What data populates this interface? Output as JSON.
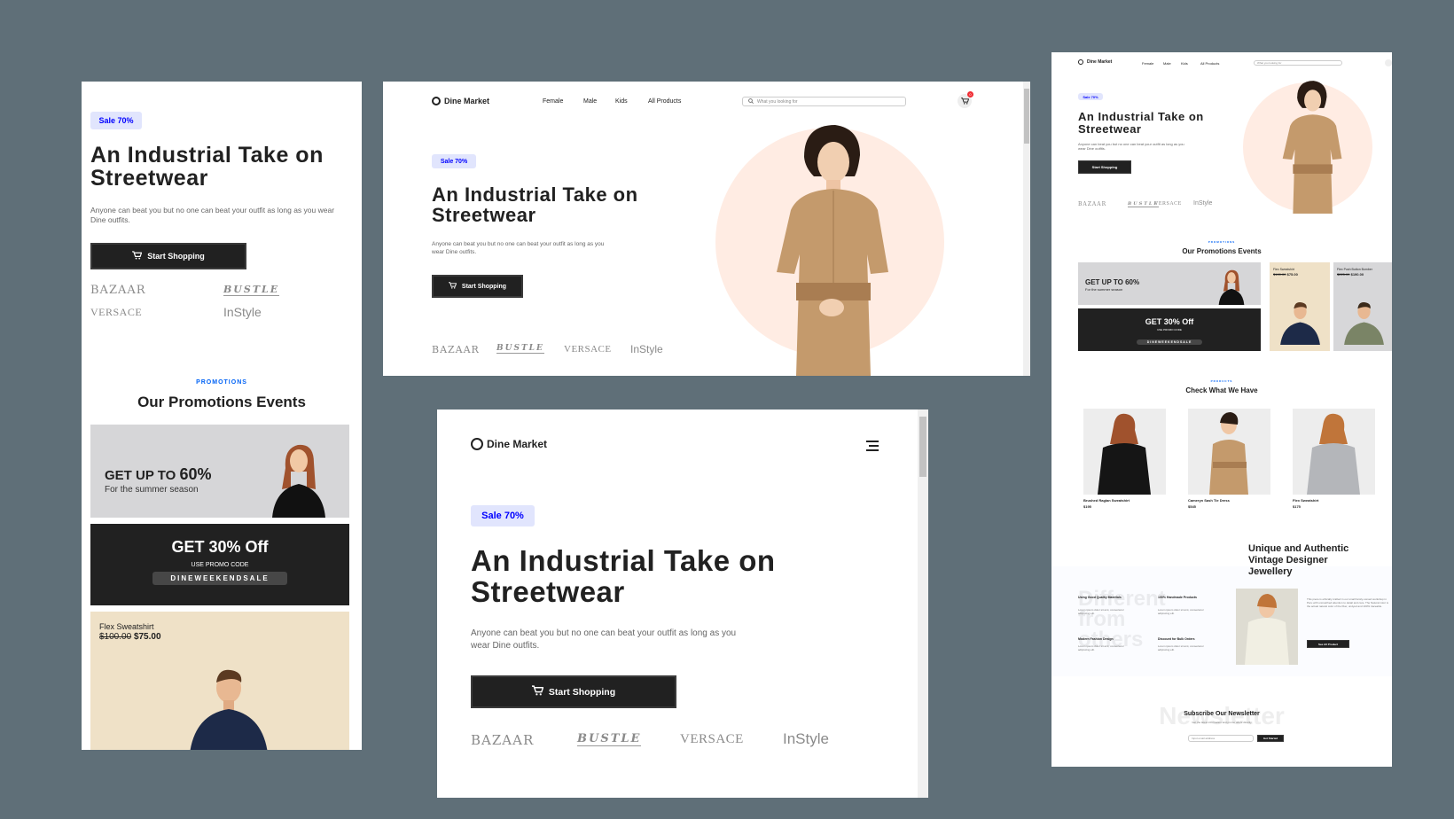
{
  "brand": {
    "name": "Dine Market"
  },
  "nav": {
    "female": "Female",
    "male": "Male",
    "kids": "Kids",
    "all": "All Products"
  },
  "search": {
    "placeholder": "What you looking for"
  },
  "cart": {
    "count": "0"
  },
  "hero": {
    "badge": "Sale 70%",
    "title_line1": "An Industrial Take on",
    "title_line2": "Streetwear",
    "desc": "Anyone can beat you but no one can beat your outfit as long as you wear Dine outfits.",
    "desc_short": "Anyone can beat you but no one can beat your outfit as long as you wear Dine outfits.",
    "cta": "Start Shopping"
  },
  "brands": [
    "BAZAAR",
    "BUSTLE",
    "VERSACE",
    "InStyle"
  ],
  "promotions": {
    "label": "PROMOTIONS",
    "title": "Our Promotions Events",
    "card1_title": "GET UP TO",
    "card1_pct": "60%",
    "card1_sub": "For the summer season",
    "card2_title": "GET 30% Off",
    "card2_sub": "USE PROMO CODE",
    "card2_code": "DINEWEEKENDSALE",
    "card3_name": "Flex Sweatshirt",
    "card3_old": "$100.00",
    "card3_new": "$75.00",
    "card4_name": "Flex Push Button Bomber",
    "card4_old": "$225.00",
    "card4_new": "$190.00"
  },
  "products": {
    "label": "PRODUCTS",
    "title": "Check What We Have",
    "items": [
      {
        "name": "Brushed Raglan Sweatshirt",
        "price": "$195"
      },
      {
        "name": "Cameryn Sash Tie Dress",
        "price": "$545"
      },
      {
        "name": "Flex Sweatshirt",
        "price": "$175"
      }
    ]
  },
  "unique": {
    "title_line1": "Unique and Authentic",
    "title_line2": "Vintage Designer",
    "title_line3": "Jewellery",
    "ghost": "Different from others",
    "f1": "Using Good Quality Materials",
    "f2": "100% Handmade Products",
    "f3": "Modern Fashion Design",
    "f4": "Discount for Bulk Orders",
    "fdesc": "Lorem ipsum dolor sit amt, consectetur adipiscing elit.",
    "body": "This piece is ethically crafted in our small family-owned workshop in Peru with unmatched attention to detail and care. The Natural color is the actual natural color of the fiber, undyed and 100% traceable.",
    "cta": "See All Product"
  },
  "newsletter": {
    "ghost": "Newsletter",
    "title": "Subscribe Our Newsletter",
    "sub": "Get the latest information and promo offers directly",
    "placeholder": "Input email address",
    "cta": "Get Started"
  },
  "colors": {
    "bg": "#5f6f78",
    "dark": "#212121",
    "badge_bg": "#e1e5fd",
    "badge_text": "#0000ff",
    "peach": "#ffece3"
  }
}
